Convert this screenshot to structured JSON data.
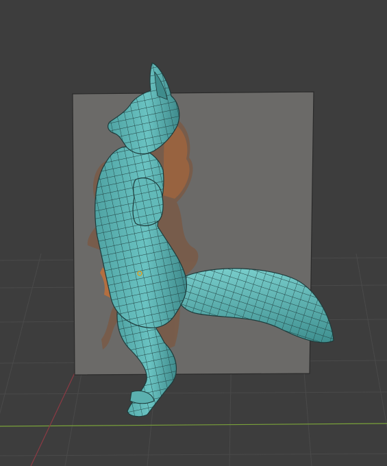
{
  "viewport": {
    "mode": "3d-viewport",
    "background_color": "#3d3d3d",
    "grid_color": "#4a4a4a",
    "x_axis_color": "#8c3a44",
    "y_axis_color": "#7aa23a"
  },
  "scene": {
    "objects": [
      {
        "name": "reference-image-plane",
        "type": "image-plane",
        "color": "#6b6a68"
      },
      {
        "name": "fox-reference",
        "type": "reference-image",
        "color": "#8a5535"
      },
      {
        "name": "fox-mesh",
        "type": "mesh",
        "display": "wireframe-overlay",
        "color": "#5fb7b6",
        "wire_color": "#1e3c3c"
      },
      {
        "name": "origin-point",
        "type": "object-origin",
        "color": "#e0a020"
      }
    ]
  }
}
